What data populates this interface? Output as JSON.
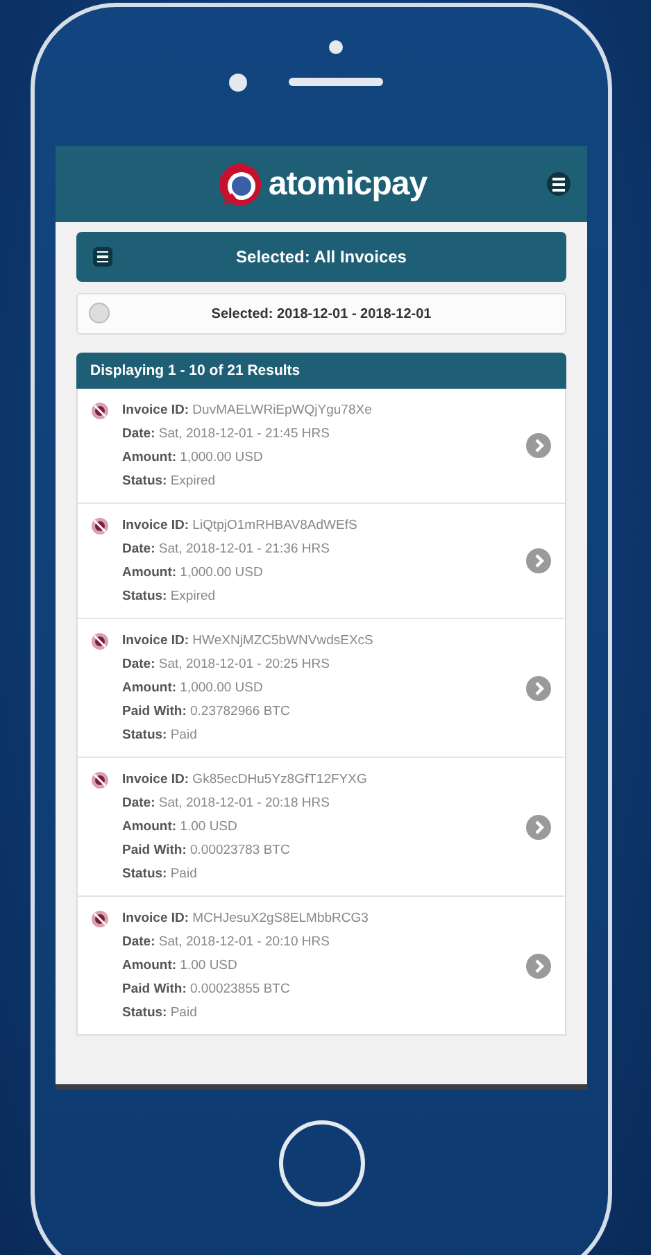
{
  "header": {
    "logo_text": "atomicpay"
  },
  "filter_bar": {
    "label": "Selected: All Invoices"
  },
  "date_range": {
    "label": "Selected: 2018-12-01 - 2018-12-01"
  },
  "results": {
    "title": "Displaying 1 - 10 of 21 Results"
  },
  "invoices": [
    {
      "lines": [
        "**Invoice ID:** DuvMAELWRiEpWQjYgu78Xe",
        "**Date:** Sat, 2018-12-01 - 21:45 HRS",
        "**Amount:** 1,000.00 USD",
        "**Status:** Expired"
      ]
    },
    {
      "lines": [
        "**Invoice ID:** LiQtpjO1mRHBAV8AdWEfS",
        "**Date:** Sat, 2018-12-01 - 21:36 HRS",
        "**Amount:** 1,000.00 USD",
        "**Status:** Expired"
      ]
    },
    {
      "lines": [
        "**Invoice ID:** HWeXNjMZC5bWNVwdsEXcS",
        "**Date:** Sat, 2018-12-01 - 20:25 HRS",
        "**Amount:** 1,000.00 USD",
        "**Paid With:** 0.23782966 BTC",
        "**Status:** Paid"
      ]
    },
    {
      "lines": [
        "**Invoice ID:** Gk85ecDHu5Yz8GfT12FYXG",
        "**Date:** Sat, 2018-12-01 - 20:18 HRS",
        "**Amount:** 1.00 USD",
        "**Paid With:** 0.00023783 BTC",
        "**Status:** Paid"
      ]
    },
    {
      "lines": [
        "**Invoice ID:** MCHJesuX2gS8ELMbbRCG3",
        "**Date:** Sat, 2018-12-01 - 20:10 HRS",
        "**Amount:** 1.00 USD",
        "**Paid With:** 0.00023855 BTC",
        "**Status:** Paid"
      ]
    }
  ]
}
